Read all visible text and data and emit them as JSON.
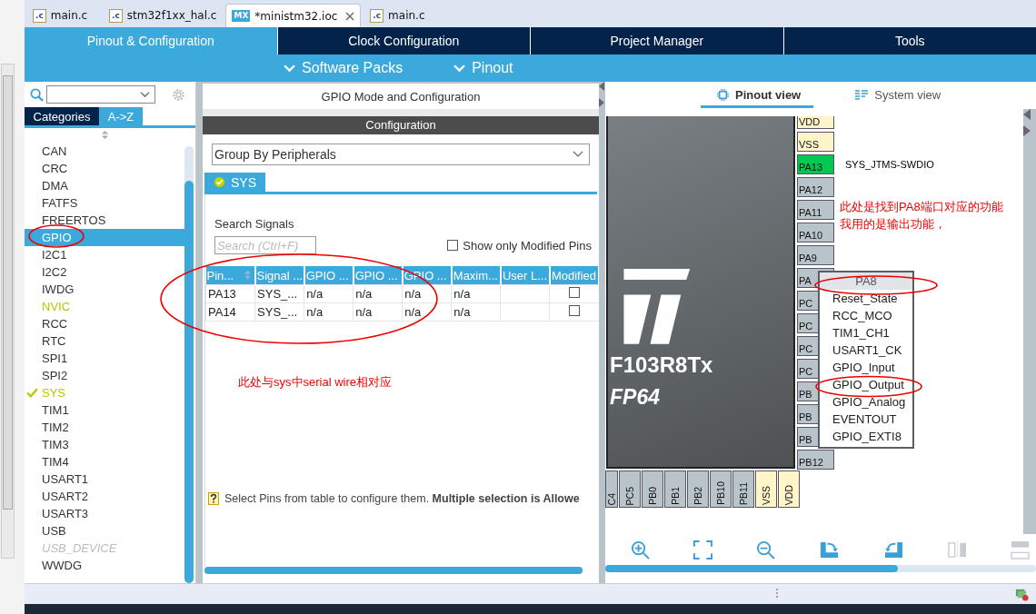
{
  "editor_tabs": [
    {
      "label": "main.c",
      "badge": ".c",
      "kind": "c",
      "selected": false,
      "closable": false
    },
    {
      "label": "stm32f1xx_hal.c",
      "badge": ".c",
      "kind": "c",
      "selected": false,
      "closable": false
    },
    {
      "label": "*ministm32.ioc",
      "badge": "MX",
      "kind": "mx",
      "selected": true,
      "closable": true
    },
    {
      "label": "main.c",
      "badge": ".c",
      "kind": "c",
      "selected": false,
      "closable": false
    }
  ],
  "nav_tabs": [
    {
      "label": "Pinout & Configuration",
      "selected": true
    },
    {
      "label": "Clock Configuration",
      "selected": false
    },
    {
      "label": "Project Manager",
      "selected": false
    },
    {
      "label": "Tools",
      "selected": false
    }
  ],
  "sub_menus": [
    "Software Packs",
    "Pinout"
  ],
  "sidebar": {
    "view_tabs": [
      {
        "label": "Categories",
        "selected": true
      },
      {
        "label": "A->Z",
        "selected": false
      }
    ],
    "items": [
      {
        "label": "CAN",
        "kind": "plain",
        "selected": false
      },
      {
        "label": "CRC",
        "kind": "plain",
        "selected": false
      },
      {
        "label": "DMA",
        "kind": "plain",
        "selected": false
      },
      {
        "label": "FATFS",
        "kind": "plain",
        "selected": false
      },
      {
        "label": "FREERTOS",
        "kind": "plain",
        "selected": false
      },
      {
        "label": "GPIO",
        "kind": "plain",
        "selected": true
      },
      {
        "label": "I2C1",
        "kind": "plain",
        "selected": false
      },
      {
        "label": "I2C2",
        "kind": "plain",
        "selected": false
      },
      {
        "label": "IWDG",
        "kind": "plain",
        "selected": false
      },
      {
        "label": "NVIC",
        "kind": "warning",
        "selected": false
      },
      {
        "label": "RCC",
        "kind": "plain",
        "selected": false
      },
      {
        "label": "RTC",
        "kind": "plain",
        "selected": false
      },
      {
        "label": "SPI1",
        "kind": "plain",
        "selected": false
      },
      {
        "label": "SPI2",
        "kind": "plain",
        "selected": false
      },
      {
        "label": "SYS",
        "kind": "ok",
        "selected": false
      },
      {
        "label": "TIM1",
        "kind": "plain",
        "selected": false
      },
      {
        "label": "TIM2",
        "kind": "plain",
        "selected": false
      },
      {
        "label": "TIM3",
        "kind": "plain",
        "selected": false
      },
      {
        "label": "TIM4",
        "kind": "plain",
        "selected": false
      },
      {
        "label": "USART1",
        "kind": "plain",
        "selected": false
      },
      {
        "label": "USART2",
        "kind": "plain",
        "selected": false
      },
      {
        "label": "USART3",
        "kind": "plain",
        "selected": false
      },
      {
        "label": "USB",
        "kind": "plain",
        "selected": false
      },
      {
        "label": "USB_DEVICE",
        "kind": "disabled",
        "selected": false
      },
      {
        "label": "WWDG",
        "kind": "plain",
        "selected": false
      }
    ]
  },
  "mode_panel": {
    "title": "GPIO Mode and Configuration",
    "config_title": "Configuration",
    "group_by": "Group By Peripherals",
    "tabs": [
      {
        "label": "SYS",
        "selected": true
      }
    ],
    "search_label": "Search Signals",
    "search_placeholder": "Search (Ctrl+F)",
    "show_modified": {
      "label": "Show only Modified Pins",
      "checked": false
    },
    "table": {
      "columns": [
        "Pin...",
        "Signal ...",
        "GPIO ...",
        "GPIO ...",
        "GPIO ...",
        "Maxim...",
        "User L...",
        "Modified"
      ],
      "rows": [
        {
          "cells": [
            "PA13",
            "SYS_...",
            "n/a",
            "n/a",
            "n/a",
            "n/a",
            ""
          ],
          "modified": false
        },
        {
          "cells": [
            "PA14",
            "SYS_...",
            "n/a",
            "n/a",
            "n/a",
            "n/a",
            ""
          ],
          "modified": false
        }
      ]
    },
    "note": "此处与sys中serial wire相对应",
    "hint": "Select Pins from table to configure them. **Multiple selection is Allowe**"
  },
  "pinout": {
    "view_tabs": [
      {
        "label": "Pinout view",
        "selected": true
      },
      {
        "label": "System view",
        "selected": false
      }
    ],
    "chip": {
      "name": "F103R8Tx",
      "package": "FP64"
    },
    "right_pins": [
      {
        "label": "VDD",
        "kind": "power"
      },
      {
        "label": "VSS",
        "kind": "power"
      },
      {
        "label": "PA13",
        "kind": "assigned",
        "signal": "SYS_JTMS-SWDIO"
      },
      {
        "label": "PA12",
        "kind": "io"
      },
      {
        "label": "PA11",
        "kind": "io"
      },
      {
        "label": "PA10",
        "kind": "io"
      },
      {
        "label": "PA9",
        "kind": "io"
      },
      {
        "label": "PA",
        "kind": "io"
      },
      {
        "label": "PC",
        "kind": "io"
      },
      {
        "label": "PC",
        "kind": "io"
      },
      {
        "label": "PC",
        "kind": "io"
      },
      {
        "label": "PC",
        "kind": "io"
      },
      {
        "label": "PB",
        "kind": "io"
      },
      {
        "label": "PB",
        "kind": "io"
      },
      {
        "label": "PB",
        "kind": "io"
      },
      {
        "label": "PB12",
        "kind": "io"
      }
    ],
    "bottom_pins": [
      {
        "label": "C4",
        "kind": "io"
      },
      {
        "label": "PC5",
        "kind": "io"
      },
      {
        "label": "PB0",
        "kind": "io"
      },
      {
        "label": "PB1",
        "kind": "io"
      },
      {
        "label": "PB2",
        "kind": "io"
      },
      {
        "label": "PB10",
        "kind": "io"
      },
      {
        "label": "PB11",
        "kind": "io"
      },
      {
        "label": "VSS",
        "kind": "power"
      },
      {
        "label": "VDD",
        "kind": "power"
      }
    ],
    "popup": {
      "title": "PA8",
      "items": [
        "Reset_State",
        "RCC_MCO",
        "TIM1_CH1",
        "USART1_CK",
        "GPIO_Input",
        "GPIO_Output",
        "GPIO_Analog",
        "EVENTOUT",
        "GPIO_EXTI8"
      ]
    },
    "notes": [
      "此处是找到PA8端口对应的功能",
      "我用的是输出功能，"
    ]
  }
}
